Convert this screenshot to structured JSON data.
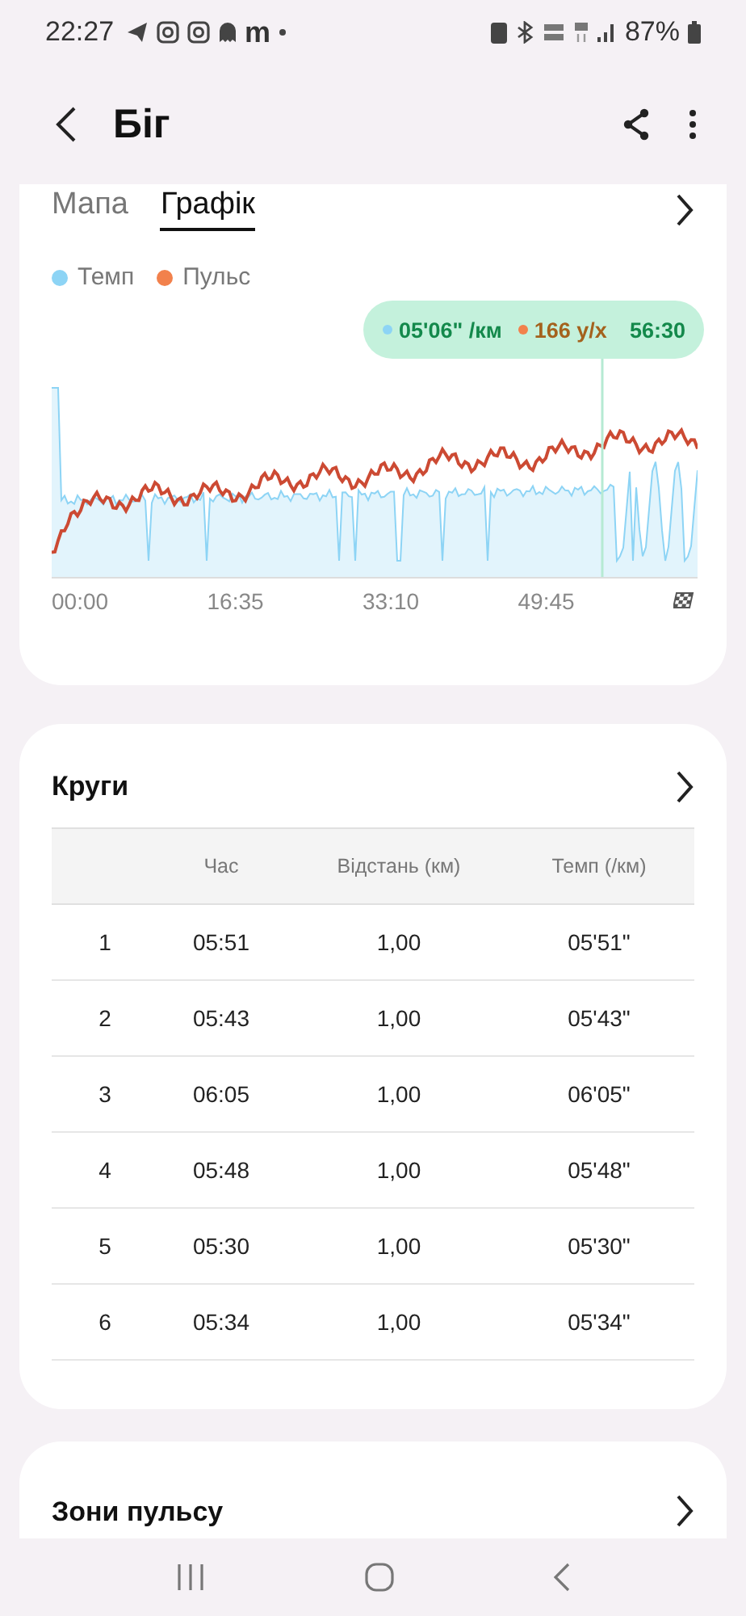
{
  "status_bar": {
    "time": "22:27",
    "notification_letter": "m",
    "battery": "87%"
  },
  "header": {
    "title": "Біг"
  },
  "chart_card": {
    "tabs": [
      {
        "label": "Мапа",
        "selected": false
      },
      {
        "label": "Графік",
        "selected": true
      }
    ],
    "legend": [
      {
        "label": "Темп",
        "color": "#8dd4f5"
      },
      {
        "label": "Пульс",
        "color": "#f2814c"
      }
    ],
    "tooltip": {
      "pace": "05'06\" /км",
      "pulse": "166 у/х",
      "time": "56:30"
    },
    "x_labels": [
      "00:00",
      "16:35",
      "33:10",
      "49:45"
    ]
  },
  "laps": {
    "title": "Круги",
    "columns": [
      "Час",
      "Відстань (км)",
      "Темп (/км)"
    ],
    "rows": [
      {
        "n": "1",
        "time": "05:51",
        "distance": "1,00",
        "pace": "05'51\""
      },
      {
        "n": "2",
        "time": "05:43",
        "distance": "1,00",
        "pace": "05'43\""
      },
      {
        "n": "3",
        "time": "06:05",
        "distance": "1,00",
        "pace": "06'05\""
      },
      {
        "n": "4",
        "time": "05:48",
        "distance": "1,00",
        "pace": "05'48\""
      },
      {
        "n": "5",
        "time": "05:30",
        "distance": "1,00",
        "pace": "05'30\""
      },
      {
        "n": "6",
        "time": "05:34",
        "distance": "1,00",
        "pace": "05'34\""
      }
    ]
  },
  "zones": {
    "title": "Зони пульсу"
  }
}
